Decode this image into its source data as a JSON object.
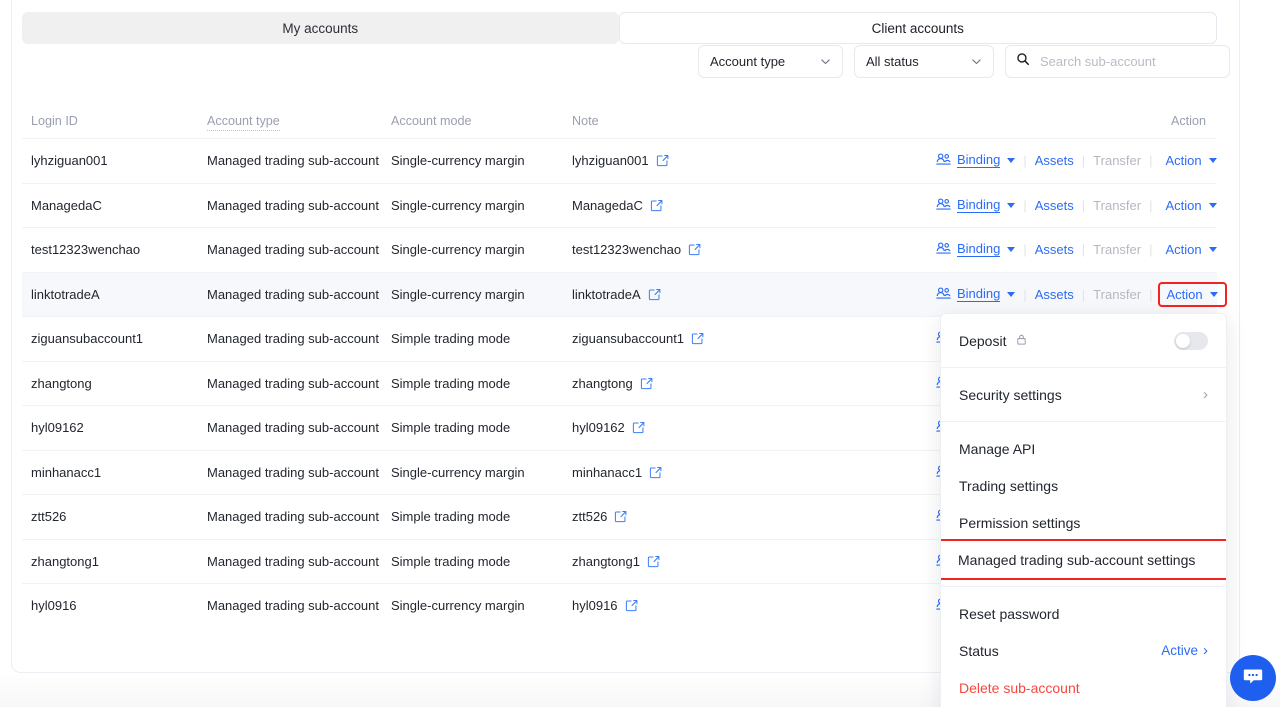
{
  "tabs": [
    {
      "label": "My accounts",
      "active": false
    },
    {
      "label": "Client accounts",
      "active": true
    }
  ],
  "filters": {
    "account_type": "Account type",
    "status": "All status",
    "search_placeholder": "Search sub-account",
    "search_value": "",
    "search_icon": "search-icon",
    "chevron_icon": "chevron-down-icon"
  },
  "table": {
    "columns": [
      "Login ID",
      "Account type",
      "Account mode",
      "Note",
      "Action"
    ],
    "row_actions": {
      "binding": "Binding",
      "assets": "Assets",
      "transfer": "Transfer",
      "action": "Action",
      "binding_icon": "users-icon",
      "edit_icon": "edit-note-icon"
    },
    "rows": [
      {
        "login_id": "lyhziguan001",
        "account_type": "Managed trading sub-account",
        "account_mode": "Single-currency margin",
        "note": "lyhziguan001"
      },
      {
        "login_id": "ManagedaC",
        "account_type": "Managed trading sub-account",
        "account_mode": "Single-currency margin",
        "note": "ManagedaC"
      },
      {
        "login_id": "test12323wenchao",
        "account_type": "Managed trading sub-account",
        "account_mode": "Single-currency margin",
        "note": "test12323wenchao"
      },
      {
        "login_id": "linktotradeA",
        "account_type": "Managed trading sub-account",
        "account_mode": "Single-currency margin",
        "note": "linktotradeA"
      },
      {
        "login_id": "ziguansubaccount1",
        "account_type": "Managed trading sub-account",
        "account_mode": "Simple trading mode",
        "note": "ziguansubaccount1"
      },
      {
        "login_id": "zhangtong",
        "account_type": "Managed trading sub-account",
        "account_mode": "Simple trading mode",
        "note": "zhangtong"
      },
      {
        "login_id": "hyl09162",
        "account_type": "Managed trading sub-account",
        "account_mode": "Simple trading mode",
        "note": "hyl09162"
      },
      {
        "login_id": "minhanacc1",
        "account_type": "Managed trading sub-account",
        "account_mode": "Single-currency margin",
        "note": "minhanacc1"
      },
      {
        "login_id": "ztt526",
        "account_type": "Managed trading sub-account",
        "account_mode": "Simple trading mode",
        "note": "ztt526"
      },
      {
        "login_id": "zhangtong1",
        "account_type": "Managed trading sub-account",
        "account_mode": "Simple trading mode",
        "note": "zhangtong1"
      },
      {
        "login_id": "hyl0916",
        "account_type": "Managed trading sub-account",
        "account_mode": "Single-currency margin",
        "note": "hyl0916"
      }
    ]
  },
  "action_menu": {
    "deposit": {
      "label": "Deposit",
      "lock_icon": "lock-icon",
      "toggle_on": false
    },
    "security_settings": {
      "label": "Security settings",
      "chevron": "›"
    },
    "manage_api": "Manage API",
    "trading_settings": "Trading settings",
    "permission_settings": "Permission settings",
    "managed_trading_settings": "Managed trading sub-account settings",
    "reset_password": "Reset password",
    "status": {
      "label": "Status",
      "value": "Active",
      "chevron": "›"
    },
    "delete": "Delete sub-account"
  },
  "chat": {
    "icon": "chat-bubble-icon"
  },
  "colors": {
    "link_blue": "#2b6cf6",
    "danger_red": "#f5493d",
    "highlight_box": "#f5231f",
    "row_highlight": "#f7f8fb",
    "chat_blue": "#1f5ff0"
  }
}
